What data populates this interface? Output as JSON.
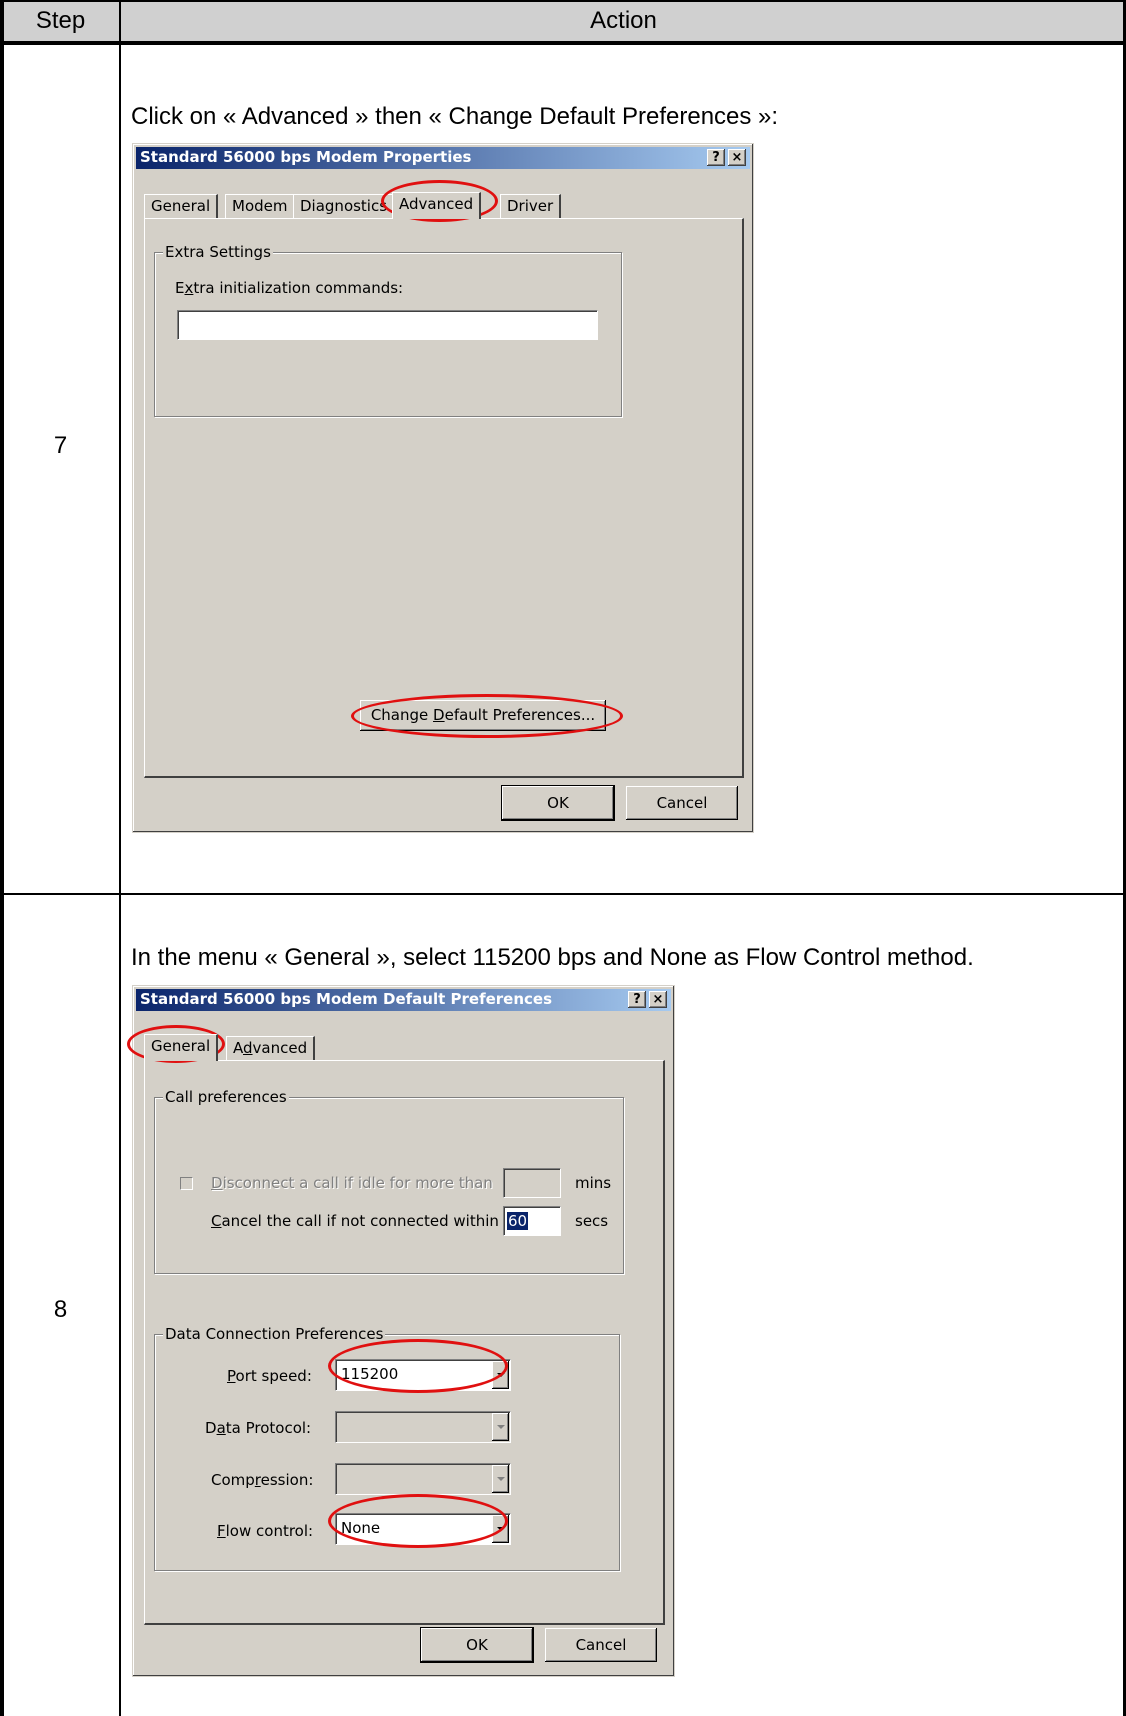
{
  "table": {
    "header_step": "Step",
    "header_action": "Action"
  },
  "step7": {
    "number": "7",
    "instruction": "Click on « Advanced » then « Change Default Preferences »:",
    "dialog": {
      "title": "Standard 56000 bps Modem Properties",
      "help_button": "?",
      "close_button": "×",
      "tabs": [
        "General",
        "Modem",
        "Diagnostics",
        "Advanced",
        "Driver"
      ],
      "active_tab": "Advanced",
      "group_label": "Extra Settings",
      "extra_init_label": "Extra initialization commands:",
      "extra_init_value": "",
      "change_prefs_button": "Change Default Preferences...",
      "ok_button": "OK",
      "cancel_button": "Cancel"
    }
  },
  "step8": {
    "number": "8",
    "instruction": "In the menu « General », select 115200 bps and None as Flow Control method.",
    "dialog": {
      "title": "Standard 56000 bps Modem Default Preferences",
      "help_button": "?",
      "close_button": "×",
      "tabs": [
        "General",
        "Advanced"
      ],
      "active_tab": "General",
      "call_prefs_label": "Call preferences",
      "disconnect_label": "Disconnect a call if idle for more than",
      "disconnect_value": "",
      "disconnect_unit": "mins",
      "cancel_call_label": "Cancel the call if not connected within",
      "cancel_call_value": "60",
      "cancel_call_unit": "secs",
      "data_conn_label": "Data Connection Preferences",
      "port_speed_label": "Port speed:",
      "port_speed_value": "115200",
      "data_protocol_label": "Data Protocol:",
      "data_protocol_value": "",
      "compression_label": "Compression:",
      "compression_value": "",
      "flow_control_label": "Flow control:",
      "flow_control_value": "None",
      "ok_button": "OK",
      "cancel_button": "Cancel"
    }
  },
  "colors": {
    "annotation": "#e01010",
    "dialog_face": "#d4d0c8",
    "titlebar_start": "#0a246a",
    "titlebar_end": "#a6caf0",
    "header_bg": "#d0d0d0"
  }
}
